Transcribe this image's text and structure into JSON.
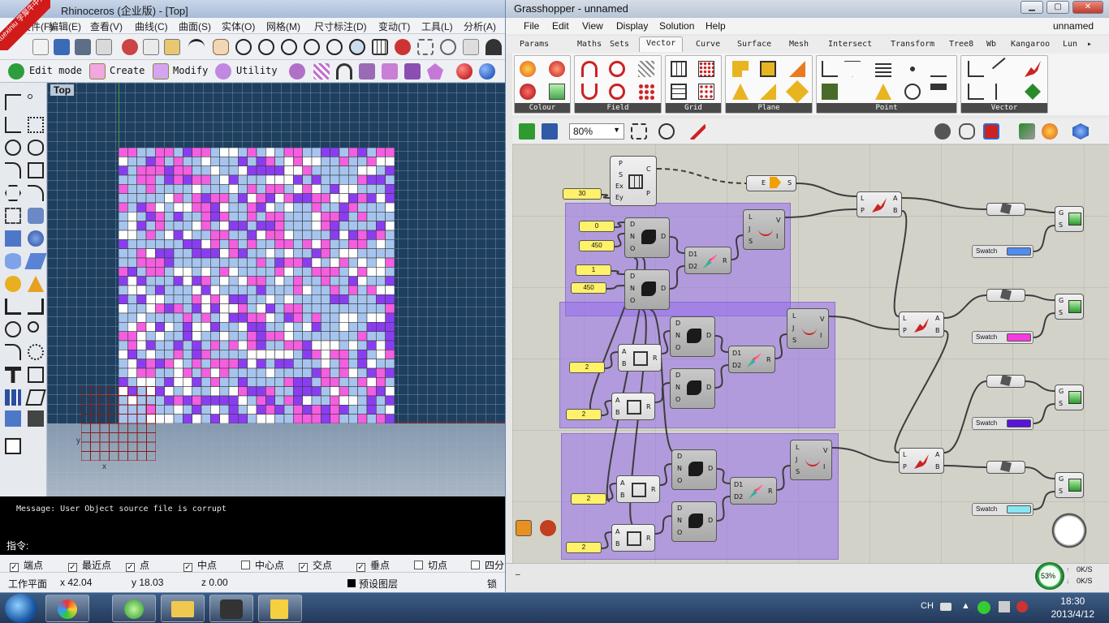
{
  "rhino": {
    "title": "Rhinoceros (企业版) - [Top]",
    "badge": "xuexiniu 学犀牛中文网",
    "menu": [
      "文件(F)",
      "编辑(E)",
      "查看(V)",
      "曲线(C)",
      "曲面(S)",
      "实体(O)",
      "网格(M)",
      "尺寸标注(D)",
      "变动(T)",
      "工具(L)",
      "分析(A)"
    ],
    "toolbar_labels": {
      "edit": "Edit mode",
      "create": "Create",
      "modify": "Modify",
      "utility": "Utility"
    },
    "viewport_label": "Top",
    "axis_x": "x",
    "axis_y": "y",
    "message": "Message: User Object source file is corrupt",
    "command_prompt": "指令:",
    "osnap": [
      {
        "label": "端点",
        "checked": true
      },
      {
        "label": "最近点",
        "checked": true
      },
      {
        "label": "点",
        "checked": true
      },
      {
        "label": "中点",
        "checked": true
      },
      {
        "label": "中心点",
        "checked": false
      },
      {
        "label": "交点",
        "checked": true
      },
      {
        "label": "垂点",
        "checked": true
      },
      {
        "label": "切点",
        "checked": false
      },
      {
        "label": "四分",
        "checked": false
      }
    ],
    "status": {
      "plane": "工作平面",
      "x": "x 42.04",
      "y": "y 18.03",
      "z": "z 0.00",
      "layer": "预设图层",
      "lock": "锁定"
    },
    "colors": {
      "light_blue": "#a6c4ee",
      "pink": "#f45ee0",
      "white": "#ffffff",
      "purple": "#8a3df0"
    }
  },
  "gh": {
    "title": "Grasshopper - unnamed",
    "doc_name": "unnamed",
    "menu": [
      "File",
      "Edit",
      "View",
      "Display",
      "Solution",
      "Help"
    ],
    "tabs": [
      "Params",
      "Maths",
      "Sets",
      "Vector",
      "Curve",
      "Surface",
      "Mesh",
      "Intersect",
      "Transform",
      "Tree8",
      "Wb",
      "Kangaroo",
      "Lun"
    ],
    "active_tab": "Vector",
    "groups": [
      "Colour",
      "Field",
      "Grid",
      "Plane",
      "Point",
      "Vector"
    ],
    "zoom": "80%",
    "sliders": [
      "30",
      "0",
      "450",
      "1",
      "450",
      "2",
      "2",
      "2",
      "2"
    ],
    "swatches": [
      {
        "label": "Swatch",
        "color": "#4f8cf2"
      },
      {
        "label": "Swatch",
        "color": "#f43ae0"
      },
      {
        "label": "Swatch",
        "color": "#5a13d8"
      },
      {
        "label": "Swatch",
        "color": "#88e6f0"
      }
    ],
    "ports": {
      "grid_in": [
        "P",
        "S",
        "Ex",
        "Ey"
      ],
      "grid_out": [
        "C",
        "P"
      ],
      "shift_in": [
        "E"
      ],
      "shift_out": [
        "S"
      ],
      "random_in": [
        "D",
        "N",
        "O"
      ],
      "random_out": [
        "D"
      ],
      "interp_in": [
        "D1",
        "D2"
      ],
      "interp_out": [
        "R"
      ],
      "remap_in": [
        "L",
        "J",
        "S"
      ],
      "remap_out": [
        "V",
        "I"
      ],
      "dispatch_in": [
        "L",
        "P"
      ],
      "dispatch_out": [
        "A",
        "B"
      ],
      "div_in": [
        "A",
        "B"
      ],
      "div_out": [
        "R"
      ],
      "preview_in": [
        "G",
        "S"
      ]
    },
    "status": {
      "cpu": "53%",
      "up": "0K/S",
      "down": "0K/S"
    }
  },
  "taskbar": {
    "lang": "CH",
    "time": "18:30",
    "date": "2013/4/12"
  }
}
